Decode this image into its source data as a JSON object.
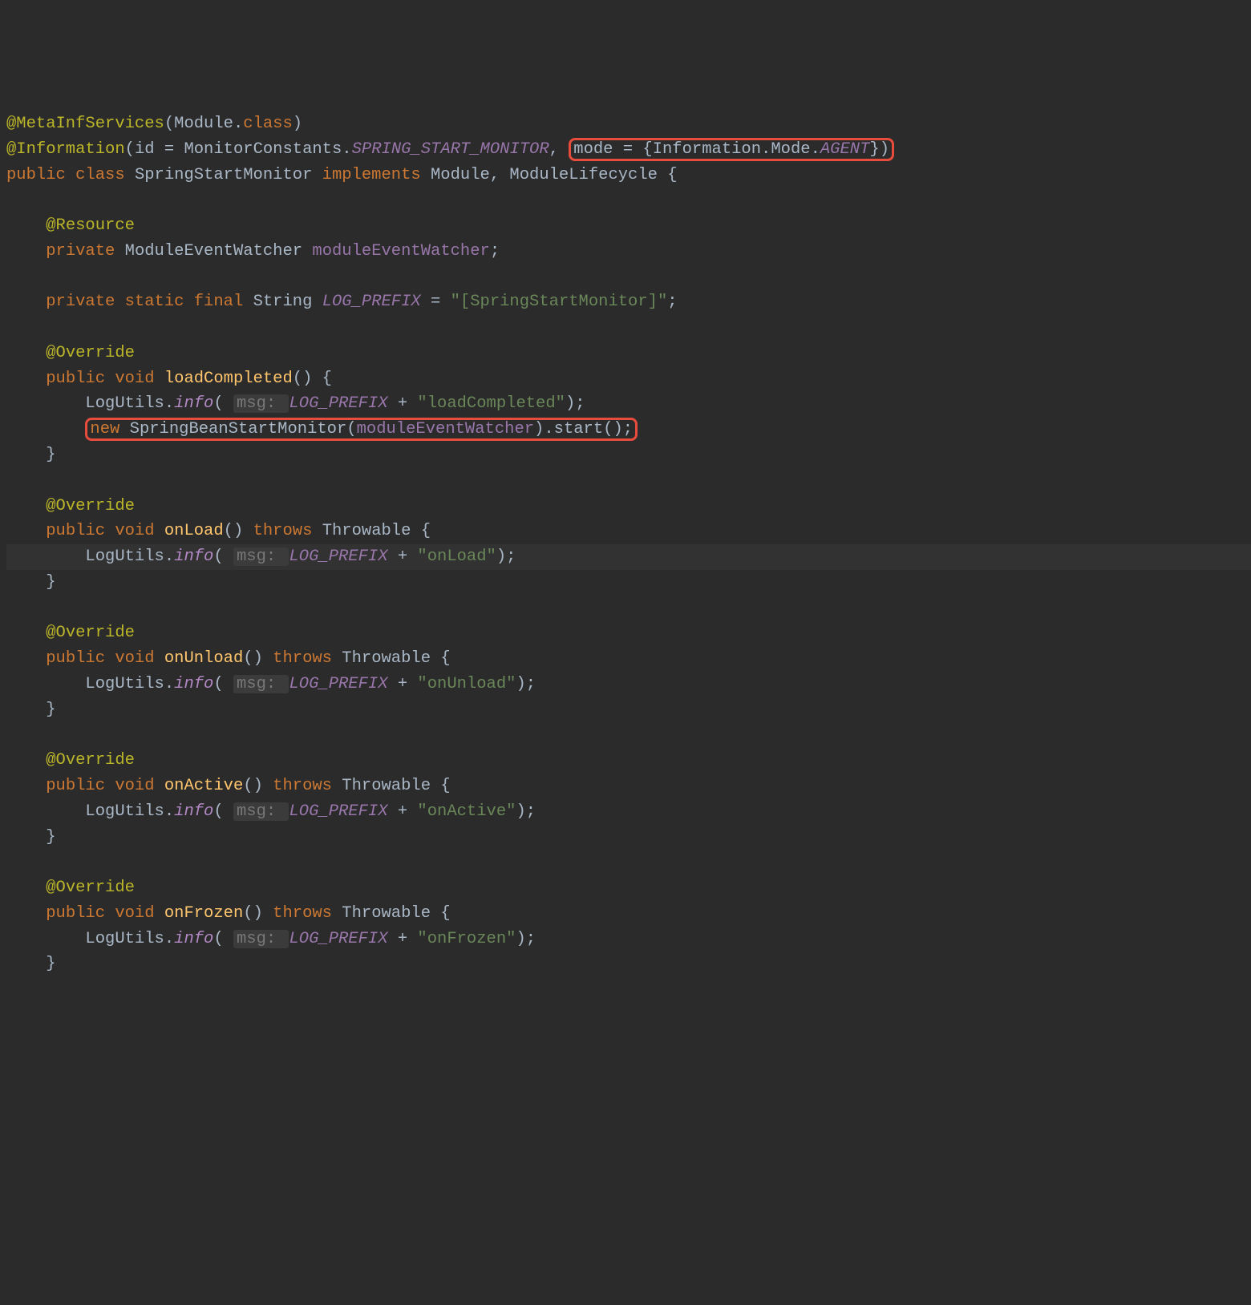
{
  "line1": {
    "anno": "@MetaInfServices",
    "open": "(",
    "cls": "Module",
    "dot": ".",
    "clskw": "class",
    "close": ")"
  },
  "line2": {
    "anno": "@Information",
    "open": "(",
    "id": "id",
    "eq": " = ",
    "mc": "MonitorConstants",
    "dot": ".",
    "ssm": "SPRING_START_MONITOR",
    "comma": ", ",
    "mode": "mode",
    "eq2": " = {",
    "info": "Information",
    "dot2": ".",
    "modeType": "Mode",
    "dot3": ".",
    "agent": "AGENT",
    "close": "})"
  },
  "line3": {
    "pub": "public class ",
    "name": "SpringStartMonitor",
    "impl": " implements ",
    "mod": "Module",
    "comma": ", ",
    "lc": "ModuleLifecycle",
    "brace": " {"
  },
  "resource": "@Resource",
  "field1": {
    "priv": "private ",
    "type": "ModuleEventWatcher ",
    "name": "moduleEventWatcher",
    "semi": ";"
  },
  "field2": {
    "mods": "private static final ",
    "type": "String ",
    "name": "LOG_PREFIX",
    "eq": " = ",
    "val": "\"[SpringStartMonitor]\"",
    "semi": ";"
  },
  "override": "@Override",
  "m_loadCompleted": {
    "sig1": "public void ",
    "name": "loadCompleted",
    "sig2": "() {",
    "log1a": "LogUtils.",
    "log1b": "info",
    "log1c": "( ",
    "hint": "msg: ",
    "lp": "LOG_PREFIX",
    "plus": " + ",
    "str": "\"loadCompleted\"",
    "end": ");",
    "new": "new ",
    "cls": "SpringBeanStartMonitor",
    "open": "(",
    "arg": "moduleEventWatcher",
    "close": ").",
    "start": "start",
    "parens": "();"
  },
  "m_onLoad": {
    "sig1": "public void ",
    "name": "onLoad",
    "sig2": "() ",
    "throws": "throws ",
    "exc": "Throwable",
    "brace": " {",
    "str": "\"onLoad\""
  },
  "m_onUnload": {
    "name": "onUnload",
    "str": "\"onUnload\""
  },
  "m_onActive": {
    "name": "onActive",
    "str": "\"onActive\""
  },
  "m_onFrozen": {
    "name": "onFrozen",
    "str": "\"onFrozen\""
  },
  "closeBrace": "}",
  "logPrefix": {
    "a": "LogUtils.",
    "b": "info",
    "c": "( ",
    "hint": "msg: ",
    "lp": "LOG_PREFIX",
    "plus": " + ",
    "end": ");"
  },
  "sig_throws": {
    "a": "public void ",
    "b": "() ",
    "throws": "throws ",
    "exc": "Throwable",
    "brace": " {"
  }
}
